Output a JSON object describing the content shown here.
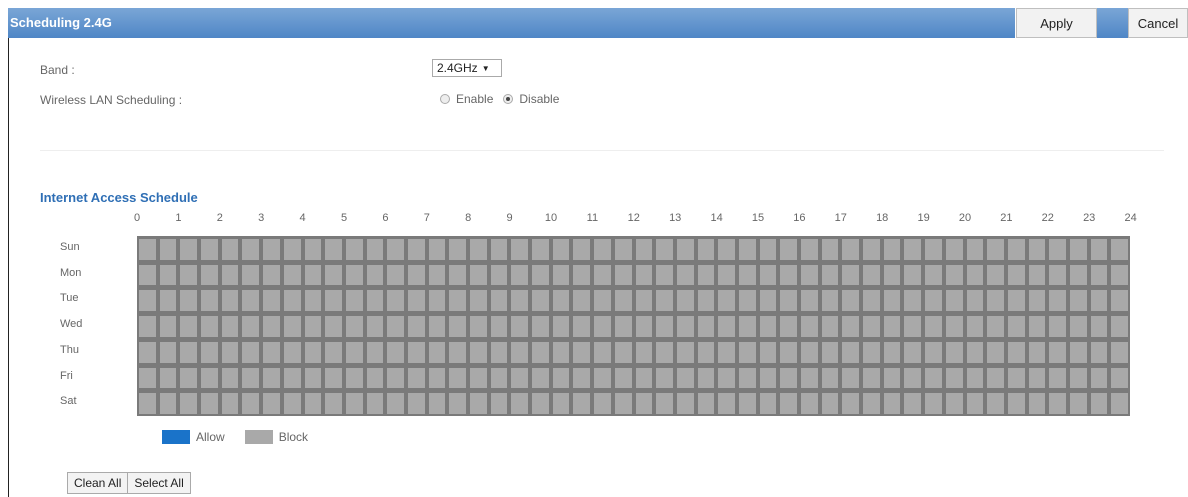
{
  "page": {
    "title": "Scheduling 2.4G",
    "apply_label": "Apply",
    "cancel_label": "Cancel"
  },
  "form": {
    "band_label": "Band :",
    "band_value": "2.4GHz",
    "wlan_scheduling_label": "Wireless LAN Scheduling :",
    "enable_label": "Enable",
    "disable_label": "Disable",
    "selected": "Disable"
  },
  "schedule": {
    "title": "Internet Access Schedule",
    "hours": [
      "0",
      "1",
      "2",
      "3",
      "4",
      "5",
      "6",
      "7",
      "8",
      "9",
      "10",
      "11",
      "12",
      "13",
      "14",
      "15",
      "16",
      "17",
      "18",
      "19",
      "20",
      "21",
      "22",
      "23",
      "24"
    ],
    "days": [
      "Sun",
      "Mon",
      "Tue",
      "Wed",
      "Thu",
      "Fri",
      "Sat"
    ],
    "state": "Block"
  },
  "legend": {
    "allow_label": "Allow",
    "block_label": "Block",
    "allow_color": "#1a73c9",
    "block_color": "#a9a9a9"
  },
  "buttons": {
    "clean_all": "Clean All",
    "select_all": "Select All"
  }
}
